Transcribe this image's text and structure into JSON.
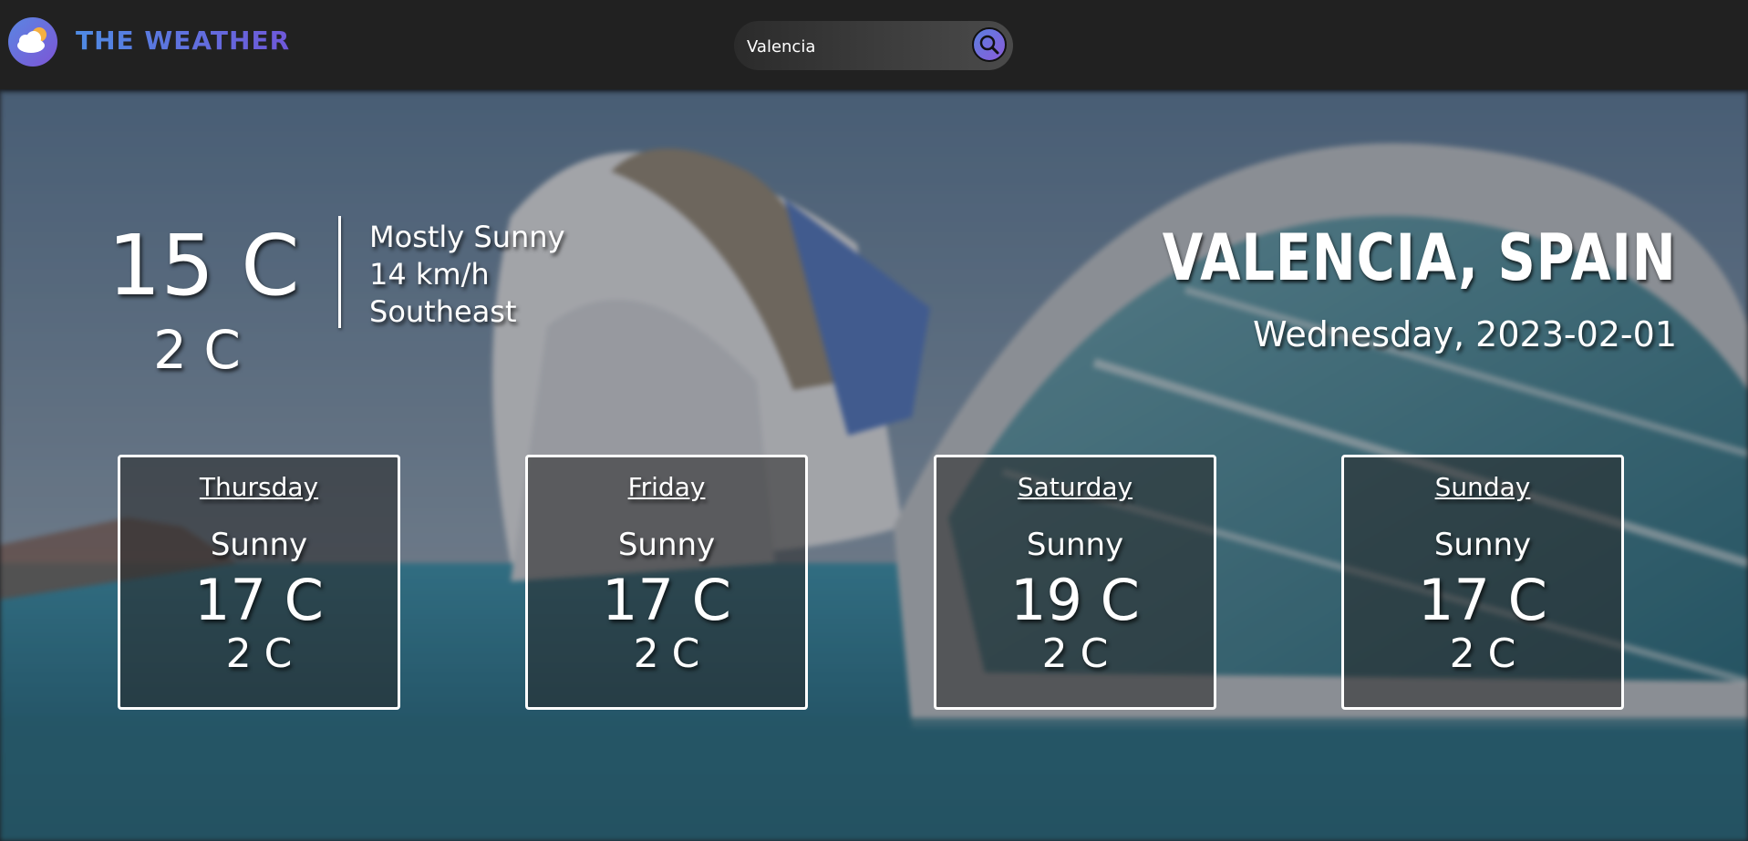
{
  "app": {
    "logo_text": "THE WEATHER",
    "logo_icon": "cloud-sun-icon"
  },
  "search": {
    "value": "Valencia",
    "icon": "search-icon"
  },
  "current": {
    "temp": "15 C",
    "min": "2 C",
    "condition": "Mostly Sunny",
    "wind_speed": "14 km/h",
    "wind_dir": "Southeast"
  },
  "location": {
    "city": "Valencia, Spain",
    "date": "Wednesday, 2023-02-01"
  },
  "forecast": [
    {
      "day": "Thursday",
      "condition": "Sunny",
      "max": "17 C",
      "min": "2 C"
    },
    {
      "day": "Friday",
      "condition": "Sunny",
      "max": "17 C",
      "min": "2 C"
    },
    {
      "day": "Saturday",
      "condition": "Sunny",
      "max": "19 C",
      "min": "2 C"
    },
    {
      "day": "Sunday",
      "condition": "Sunny",
      "max": "17 C",
      "min": "2 C"
    }
  ],
  "colors": {
    "topbar": "#212121",
    "accent_start": "#4f8be3",
    "accent_end": "#6f58d9"
  }
}
